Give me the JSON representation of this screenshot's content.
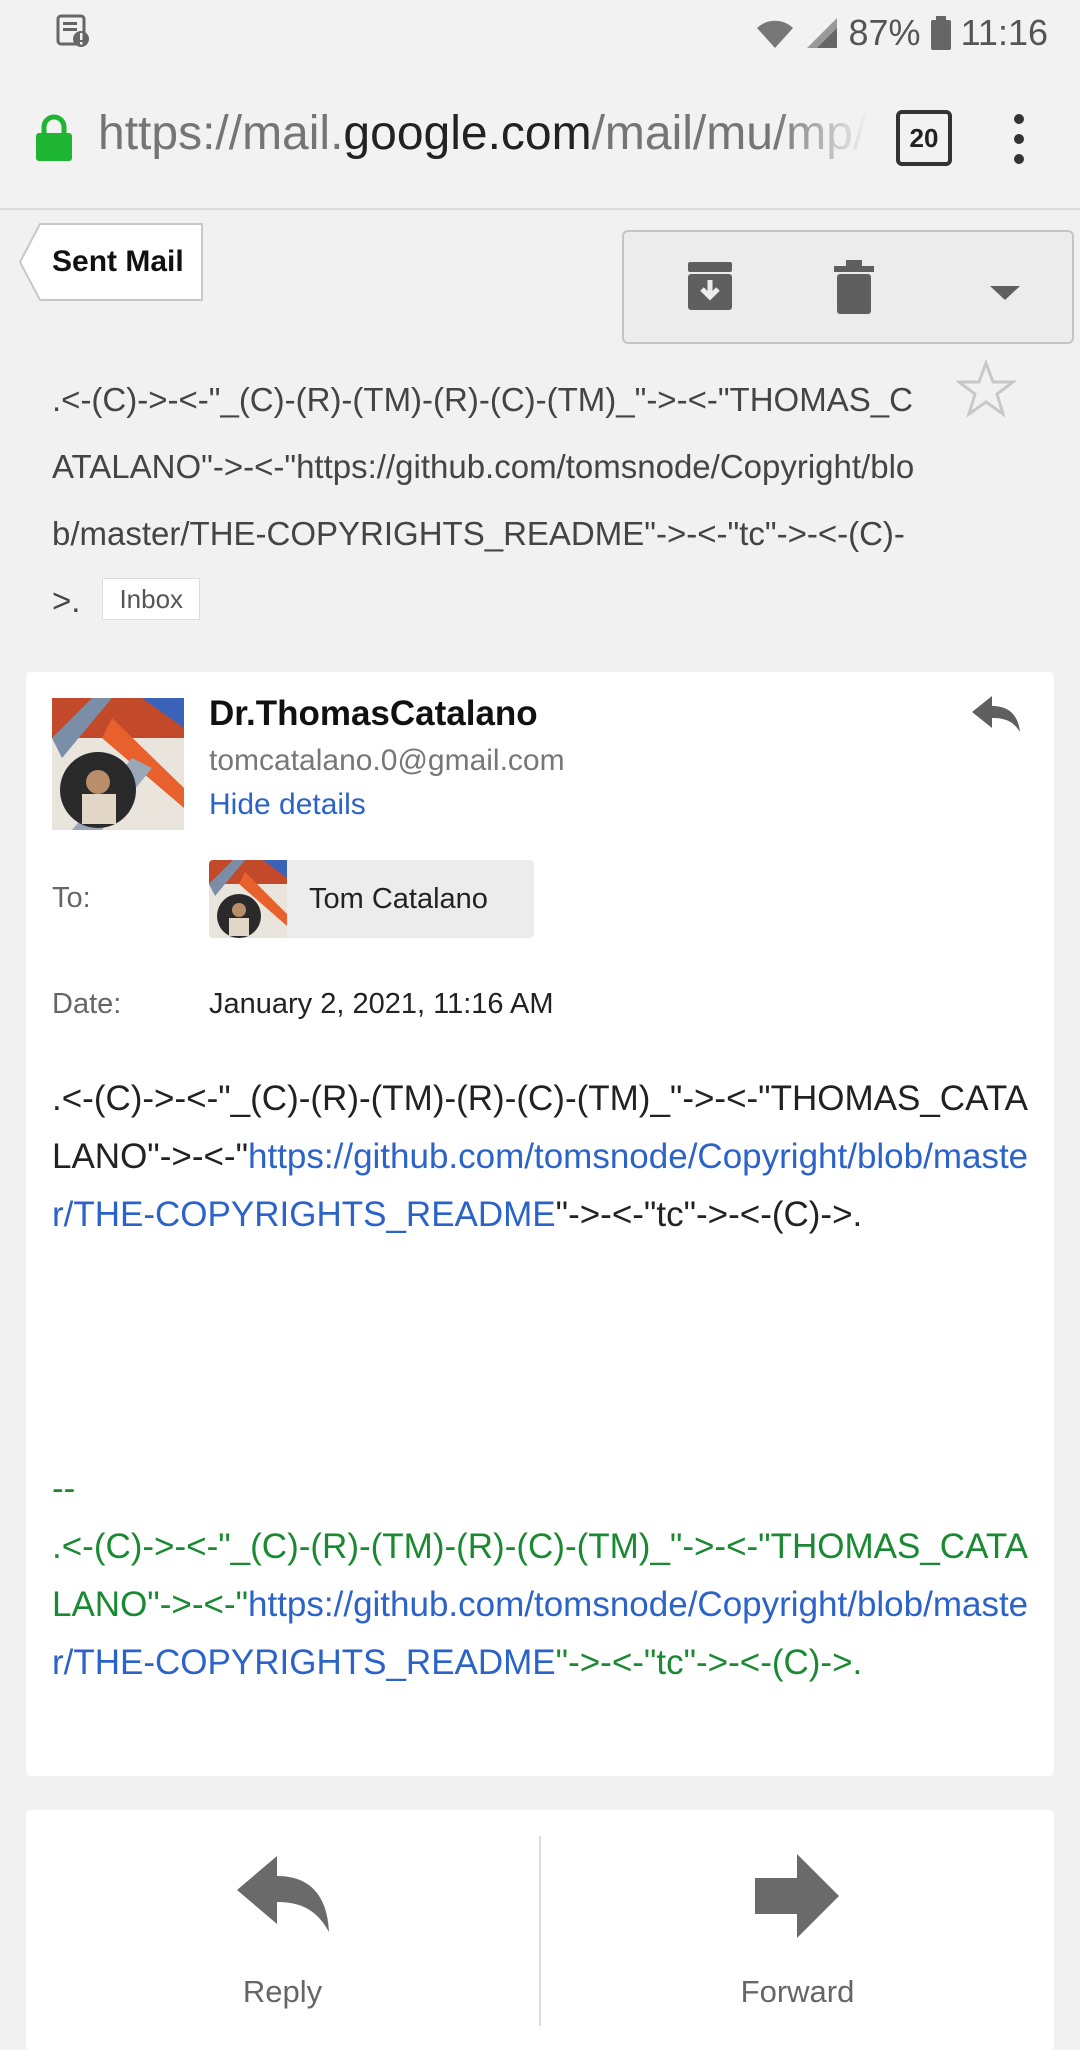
{
  "status_bar": {
    "battery": "87%",
    "time": "11:16",
    "icons": [
      "notification-icon",
      "wifi-icon",
      "signal-icon",
      "battery-icon"
    ]
  },
  "browser": {
    "url_scheme": "https://mail.",
    "url_host": "google.com",
    "url_path": "/mail/mu/mp/",
    "tab_count": "20"
  },
  "toolbar": {
    "back_label": "Sent Mail",
    "actions": [
      "archive-icon",
      "trash-icon",
      "dropdown-icon"
    ]
  },
  "subject": {
    "text": ".<-(C)->-<-\"_(C)-(R)-(TM)-(R)-(C)-(TM)_\"->-<-\"THOMAS_CATALANO\"->-<-\"https://github.com/tomsnode/Copyright/blob/master/THE-COPYRIGHTS_README\"->-<-\"tc\"->-<-(C)->.",
    "label": "Inbox"
  },
  "message": {
    "sender_name": "Dr.ThomasCatalano",
    "sender_email": "tomcatalano.0@gmail.com",
    "hide_details": "Hide details",
    "to_label": "To:",
    "to_name": "Tom Catalano",
    "date_label": "Date:",
    "date_value": "January 2, 2021, 11:16 AM",
    "body_pre": ".<-(C)->-<-\"_(C)-(R)-(TM)-(R)-(C)-(TM)_\"->-<-\"THOMAS_CATALANO\"->-<-\"",
    "body_link": "https://github.com/tomsnode/Copyright/blob/master/THE-COPYRIGHTS_README",
    "body_post": "\"->-<-\"tc\"->-<-(C)->.",
    "sig_dashes": "--",
    "sig_pre": ".<-(C)->-<-\"_(C)-(R)-(TM)-(R)-(C)-(TM)_\"->-<-\"THOMAS_CATALANO\"->-<-\"",
    "sig_link": "https://github.com/tomsnode/Copyright/blob/master/THE-COPYRIGHTS_README",
    "sig_post": "\"->-<-\"tc\"->-<-(C)->."
  },
  "actions": {
    "reply_label": "Reply",
    "forward_label": "Forward"
  },
  "colors": {
    "link": "#2b63c9",
    "signature": "#1a8a32",
    "lock": "#1db532"
  }
}
